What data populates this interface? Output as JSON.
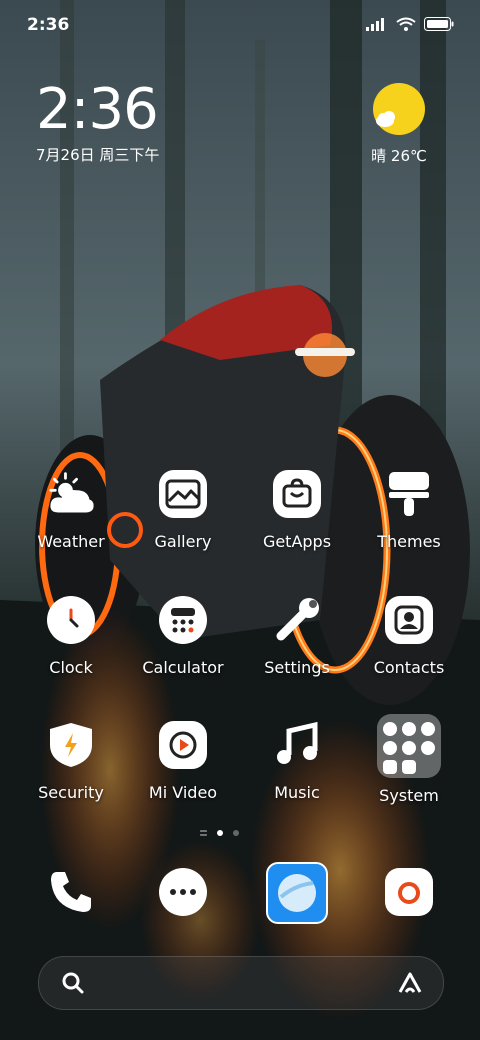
{
  "status_bar": {
    "time": "2:36"
  },
  "clock_widget": {
    "time": "2:36",
    "date": "7月26日 周三下午"
  },
  "weather_widget": {
    "condition_temp": "晴 26℃",
    "icon": "sunny-icon",
    "sun_color": "#f6d21c"
  },
  "apps": [
    {
      "label": "Weather",
      "icon": "weather-icon"
    },
    {
      "label": "Gallery",
      "icon": "gallery-icon"
    },
    {
      "label": "GetApps",
      "icon": "getapps-icon"
    },
    {
      "label": "Themes",
      "icon": "themes-icon"
    },
    {
      "label": "Clock",
      "icon": "clock-icon"
    },
    {
      "label": "Calculator",
      "icon": "calculator-icon"
    },
    {
      "label": "Settings",
      "icon": "settings-icon"
    },
    {
      "label": "Contacts",
      "icon": "contacts-icon"
    },
    {
      "label": "Security",
      "icon": "security-icon"
    },
    {
      "label": "Mi Video",
      "icon": "video-icon"
    },
    {
      "label": "Music",
      "icon": "music-icon"
    },
    {
      "label": "System",
      "icon": "folder-icon"
    }
  ],
  "page_indicator": {
    "pages": 2,
    "current": 1
  },
  "dock": [
    {
      "name": "Phone",
      "icon": "phone-icon"
    },
    {
      "name": "Messaging",
      "icon": "message-icon"
    },
    {
      "name": "Browser",
      "icon": "browser-icon"
    },
    {
      "name": "Camera",
      "icon": "camera-icon"
    }
  ],
  "search_bar": {
    "left_icon": "search-icon",
    "right_icon": "assistant-icon"
  }
}
